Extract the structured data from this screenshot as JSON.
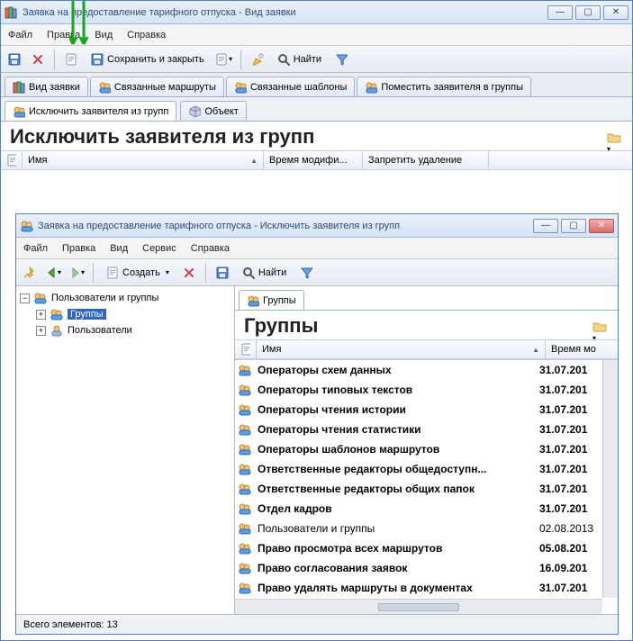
{
  "outer": {
    "title": "Заявка на предоставление тарифного отпуска - Вид заявки",
    "menus": [
      "Файл",
      "Правка",
      "Вид",
      "Справка"
    ],
    "saveClose": "Сохранить и закрыть",
    "find": "Найти",
    "tabs": [
      "Вид заявки",
      "Связанные маршруты",
      "Связанные шаблоны",
      "Поместить заявителя в группы"
    ],
    "subtabs": [
      "Исключить заявителя из групп",
      "Объект"
    ],
    "heading": "Исключить заявителя из групп",
    "cols": {
      "name": "Имя",
      "modified": "Время модифи...",
      "denyDelete": "Запретить удаление"
    }
  },
  "inner": {
    "title": "Заявка на предоставление тарифного отпуска - Исключить заявителя из групп",
    "menus": [
      "Файл",
      "Правка",
      "Вид",
      "Сервис",
      "Справка"
    ],
    "create": "Создать",
    "find": "Найти",
    "tree": {
      "root": "Пользователи и группы",
      "children": [
        "Группы",
        "Пользователи"
      ]
    },
    "right": {
      "tab": "Группы",
      "heading": "Группы",
      "cols": {
        "name": "Имя",
        "modified": "Время мо"
      }
    },
    "groups": [
      {
        "name": "Операторы схем данных",
        "date": "31.07.201",
        "bold": true
      },
      {
        "name": "Операторы типовых текстов",
        "date": "31.07.201",
        "bold": true
      },
      {
        "name": "Операторы чтения истории",
        "date": "31.07.201",
        "bold": true
      },
      {
        "name": "Операторы чтения статистики",
        "date": "31.07.201",
        "bold": true
      },
      {
        "name": "Операторы шаблонов маршрутов",
        "date": "31.07.201",
        "bold": true
      },
      {
        "name": "Ответственные редакторы общедоступн...",
        "date": "31.07.201",
        "bold": true
      },
      {
        "name": "Ответственные редакторы общих папок",
        "date": "31.07.201",
        "bold": true
      },
      {
        "name": "Отдел кадров",
        "date": "31.07.201",
        "bold": true
      },
      {
        "name": "Пользователи и группы",
        "date": "02.08.2013",
        "bold": false
      },
      {
        "name": "Право просмотра всех маршрутов",
        "date": "05.08.201",
        "bold": true
      },
      {
        "name": "Право согласования заявок",
        "date": "16.09.201",
        "bold": true
      },
      {
        "name": "Право удалять маршруты в документах",
        "date": "31.07.201",
        "bold": true
      }
    ],
    "status": "Всего элементов: 13"
  }
}
